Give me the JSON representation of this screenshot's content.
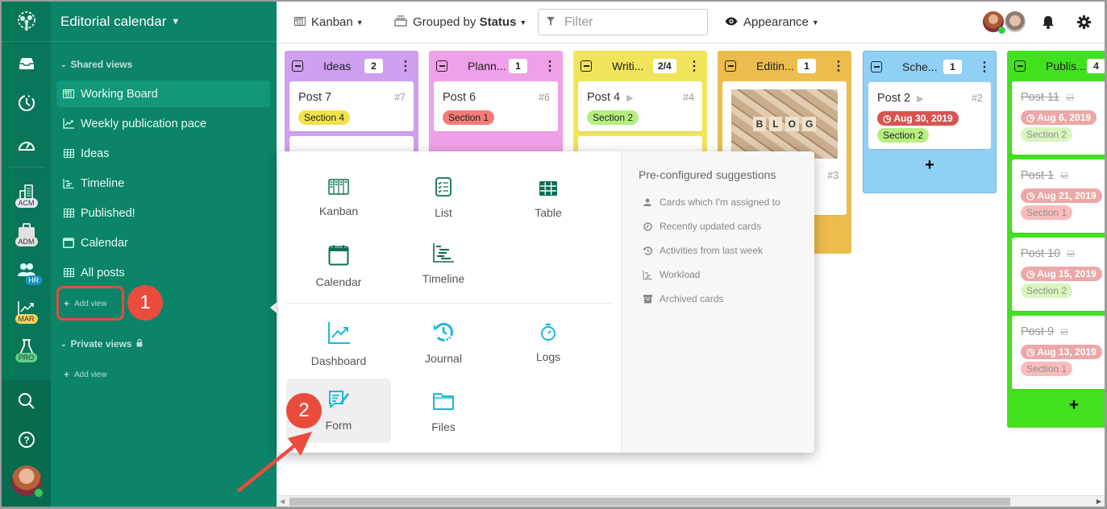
{
  "sidebar": {
    "title": "Editorial calendar",
    "shared_views_label": "Shared views",
    "private_views_label": "Private views",
    "items": [
      {
        "label": "Working Board",
        "icon": "kanban-icon",
        "active": true
      },
      {
        "label": "Weekly publication pace",
        "icon": "chart-line-icon"
      },
      {
        "label": "Ideas",
        "icon": "table-icon"
      },
      {
        "label": "Timeline",
        "icon": "timeline-icon"
      },
      {
        "label": "Published!",
        "icon": "table-icon"
      },
      {
        "label": "Calendar",
        "icon": "calendar-icon"
      },
      {
        "label": "All posts",
        "icon": "table-icon"
      }
    ],
    "add_view_label": "Add view",
    "private_add_view_label": "Add view"
  },
  "rail": {
    "workspaces": [
      {
        "badge": "ACM",
        "icon": "building-icon",
        "color": "#e8e8f5"
      },
      {
        "badge": "ADM",
        "icon": "briefcase-icon",
        "color": "#e0e0e0"
      },
      {
        "badge": "HR",
        "icon": "users-icon",
        "color": "#1a8fc0"
      },
      {
        "badge": "MAR",
        "icon": "chart-icon",
        "color": "#f5d35a"
      },
      {
        "badge": "PRO",
        "icon": "flask-icon",
        "color": "#5fd08a"
      }
    ]
  },
  "toolbar": {
    "view_type": "Kanban",
    "grouped_prefix": "Grouped by",
    "grouped_field": "Status",
    "filter_placeholder": "Filter",
    "appearance_label": "Appearance"
  },
  "board": {
    "columns": [
      {
        "title": "Ideas",
        "count": "2",
        "color": "#cf9ff0",
        "cards": [
          {
            "title": "Post 7",
            "num": "#7",
            "tags": [
              {
                "label": "Section 4",
                "color": "#f0e34a"
              }
            ]
          }
        ]
      },
      {
        "title": "Plann...",
        "count": "1",
        "color": "#f0a0e8",
        "cards": [
          {
            "title": "Post 6",
            "num": "#6",
            "tags": [
              {
                "label": "Section 1",
                "color": "#f47c78"
              }
            ]
          }
        ]
      },
      {
        "title": "Writi...",
        "count": "2/4",
        "color": "#f0e55a",
        "cards": [
          {
            "title": "Post 4",
            "num": "#4",
            "play": true,
            "tags": [
              {
                "label": "Section 2",
                "color": "#b5ef80"
              }
            ]
          }
        ]
      },
      {
        "title": "Editin...",
        "count": "1",
        "color": "#eebc4e",
        "cards": [
          {
            "title": "",
            "num": "#3",
            "image": "BLOG"
          }
        ]
      },
      {
        "title": "Sche...",
        "count": "1",
        "color": "#90d0f5",
        "cards": [
          {
            "title": "Post 2",
            "num": "#2",
            "play": true,
            "date": "Aug 30, 2019",
            "tags": [
              {
                "label": "Section 2",
                "color": "#b5ef80"
              }
            ]
          }
        ]
      },
      {
        "title": "Publis...",
        "count": "4",
        "color": "#42e01e",
        "cards": [
          {
            "title": "Post 11",
            "done": true,
            "date": "Aug 6, 2019",
            "tags": [
              {
                "label": "Section 2",
                "color": "#b5ef80"
              }
            ]
          },
          {
            "title": "Post 1",
            "done": true,
            "date": "Aug 21, 2019",
            "tags": [
              {
                "label": "Section 1",
                "color": "#f47c78"
              }
            ]
          },
          {
            "title": "Post 10",
            "done": true,
            "date": "Aug 15, 2019",
            "tags": [
              {
                "label": "Section 2",
                "color": "#b5ef80"
              }
            ]
          },
          {
            "title": "Post 9",
            "done": true,
            "date": "Aug 13, 2019",
            "tags": [
              {
                "label": "Section 1",
                "color": "#f47c78"
              }
            ]
          }
        ]
      }
    ]
  },
  "popup": {
    "view_options": [
      {
        "label": "Kanban",
        "icon": "kanban-icon"
      },
      {
        "label": "List",
        "icon": "list-icon"
      },
      {
        "label": "Table",
        "icon": "table-icon"
      },
      {
        "label": "Calendar",
        "icon": "calendar-icon"
      },
      {
        "label": "Timeline",
        "icon": "timeline-icon"
      },
      {
        "label": "Dashboard",
        "icon": "chart-line-icon"
      },
      {
        "label": "Journal",
        "icon": "history-icon"
      },
      {
        "label": "Logs",
        "icon": "stopwatch-icon"
      },
      {
        "label": "Form",
        "icon": "form-icon"
      },
      {
        "label": "Files",
        "icon": "folder-icon"
      }
    ],
    "suggestions_title": "Pre-configured suggestions",
    "suggestions": [
      {
        "label": "Cards which I'm assigned to",
        "icon": "user-icon"
      },
      {
        "label": "Recently updated cards",
        "icon": "clock-icon"
      },
      {
        "label": "Activities from last week",
        "icon": "history-icon"
      },
      {
        "label": "Workload",
        "icon": "timeline-icon"
      },
      {
        "label": "Archived cards",
        "icon": "archive-icon"
      }
    ]
  },
  "annotations": {
    "step1": "1",
    "step2": "2"
  },
  "colors": {
    "brand": "#0b8469",
    "rail": "#087658",
    "teal_icon": "#0b6e55",
    "cyan_icon": "#1bb8dc",
    "annotation": "#e94c3d",
    "date_tag": "#d9534f"
  }
}
